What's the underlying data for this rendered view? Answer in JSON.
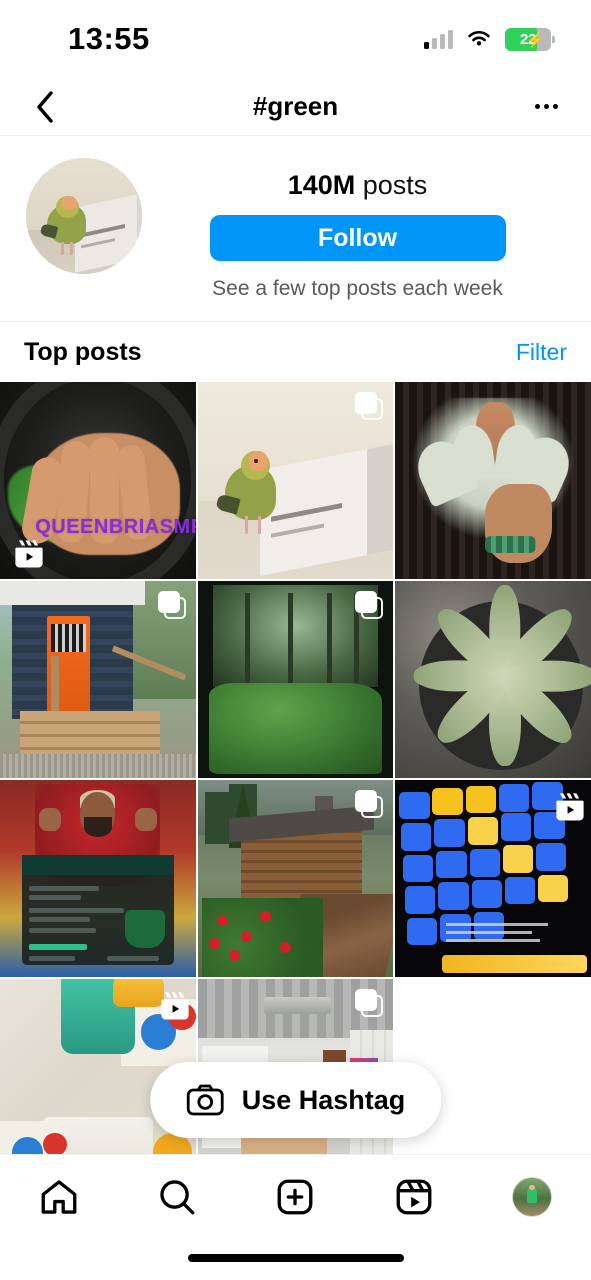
{
  "status_bar": {
    "time": "13:55",
    "battery_level": "22",
    "charging": true,
    "wifi_icon": "wifi-icon",
    "cellular_icon": "cellular-signal-icon",
    "battery_icon": "battery-charging-icon"
  },
  "header": {
    "back_icon": "chevron-left-icon",
    "title": "#green",
    "more_icon": "ellipsis-icon"
  },
  "profile": {
    "avatar_icon": "hashtag-avatar",
    "posts_count": "140M",
    "posts_label": "posts",
    "follow_label": "Follow",
    "follow_color": "#0095F6",
    "subtitle": "See a few top posts each week"
  },
  "section": {
    "title": "Top posts",
    "filter_label": "Filter",
    "filter_color": "#0095F6"
  },
  "grid": {
    "posts": [
      {
        "id": "p1",
        "description": "hands washing greens in dark bowl",
        "media_type": "reel",
        "badge_icon": "reels-icon",
        "overlay_text": "QUEENBRIASMR",
        "overlay_color": "#8A2BE2"
      },
      {
        "id": "p2",
        "description": "green parrot pecking cardboard box",
        "media_type": "carousel",
        "badge_icon": "carousel-icon",
        "overlay_text": "",
        "overlay_color": ""
      },
      {
        "id": "p3",
        "description": "staghorn fern plant held in hand",
        "media_type": "image",
        "badge_icon": "",
        "overlay_text": "",
        "overlay_color": ""
      },
      {
        "id": "p4",
        "description": "tiny house with orange front door",
        "media_type": "carousel",
        "badge_icon": "carousel-icon",
        "overlay_text": "",
        "overlay_color": ""
      },
      {
        "id": "p5",
        "description": "misty green forest with ferns",
        "media_type": "carousel",
        "badge_icon": "carousel-icon",
        "overlay_text": "",
        "overlay_color": ""
      },
      {
        "id": "p6",
        "description": "variegated agave succulent top view",
        "media_type": "image",
        "badge_icon": "",
        "overlay_text": "",
        "overlay_color": ""
      },
      {
        "id": "p7",
        "description": "football betting slip advertisement",
        "media_type": "image",
        "badge_icon": "",
        "overlay_text": "",
        "overlay_color": ""
      },
      {
        "id": "p8",
        "description": "log cabin with red roses and path",
        "media_type": "carousel",
        "badge_icon": "carousel-icon",
        "overlay_text": "",
        "overlay_color": ""
      },
      {
        "id": "p9",
        "description": "illuminated blue and yellow MIDI pad controller",
        "media_type": "reel",
        "badge_icon": "reels-icon",
        "overlay_text": "",
        "overlay_color": ""
      },
      {
        "id": "p10",
        "description": "green iced drink on patterned tiles",
        "media_type": "reel",
        "badge_icon": "reels-icon",
        "overlay_text": "",
        "overlay_color": ""
      },
      {
        "id": "p11",
        "description": "white modern kitchen interior",
        "media_type": "carousel",
        "badge_icon": "carousel-icon",
        "overlay_text": "",
        "overlay_color": ""
      }
    ]
  },
  "use_hashtag": {
    "label": "Use Hashtag",
    "icon": "camera-icon"
  },
  "tabbar": {
    "items": [
      {
        "name": "home",
        "icon": "home-icon"
      },
      {
        "name": "search",
        "icon": "search-icon"
      },
      {
        "name": "create",
        "icon": "plus-square-icon"
      },
      {
        "name": "reels",
        "icon": "reels-icon"
      },
      {
        "name": "profile",
        "icon": "profile-avatar"
      }
    ]
  }
}
